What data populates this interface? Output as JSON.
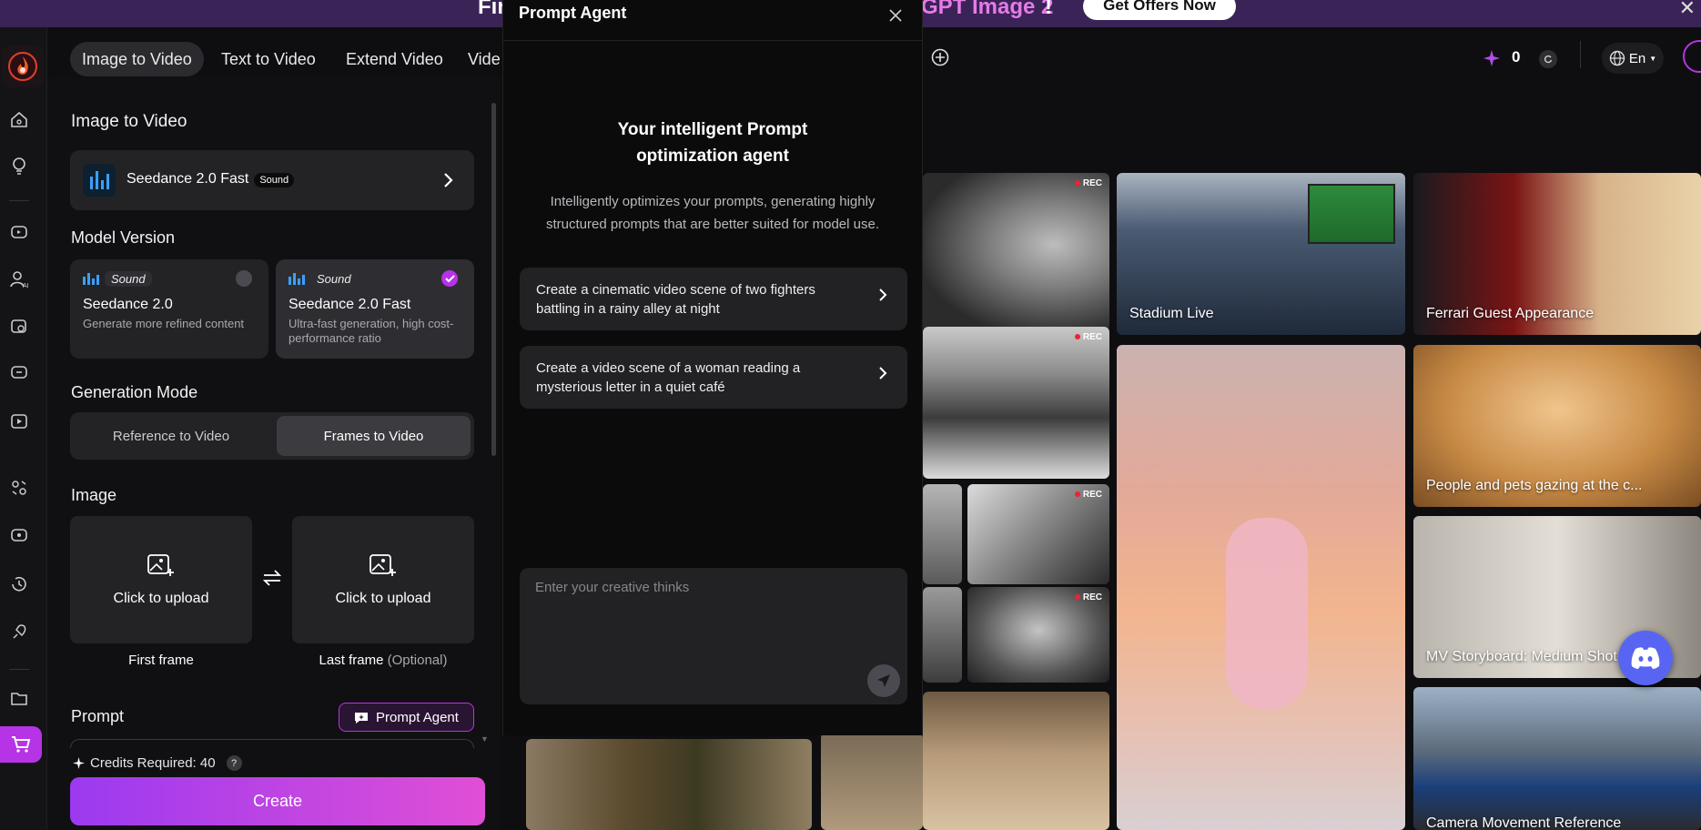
{
  "banner": {
    "left_text": "Fir",
    "mid_text": "GPT Image 2",
    "exclaim": "!",
    "offer_button": "Get Offers Now",
    "close": "✕"
  },
  "nav_tabs": [
    "Image to Video",
    "Text to Video",
    "Extend Video",
    "Vide"
  ],
  "header": {
    "credits": "0",
    "language": "En"
  },
  "panel": {
    "title": "Image to Video",
    "model": {
      "name": "Seedance 2.0 Fast",
      "badge": "Sound"
    },
    "model_version_label": "Model Version",
    "versions": [
      {
        "tag": "Sound",
        "name": "Seedance 2.0",
        "desc": "Generate more refined content",
        "selected": false
      },
      {
        "tag": "Sound",
        "name": "Seedance 2.0 Fast",
        "desc": "Ultra-fast generation, high cost-performance ratio",
        "selected": true
      }
    ],
    "generation_mode_label": "Generation Mode",
    "modes": [
      "Reference to Video",
      "Frames to Video"
    ],
    "image_label": "Image",
    "upload_text": "Click to upload",
    "first_frame": "First frame",
    "last_frame": "Last frame",
    "last_frame_optional": "(Optional)",
    "prompt_label": "Prompt",
    "prompt_agent_button": "Prompt Agent",
    "credits_required": "Credits Required: 40",
    "help": "?",
    "create_button": "Create"
  },
  "agent": {
    "title": "Prompt Agent",
    "heading_line1": "Your intelligent Prompt",
    "heading_line2": "optimization agent",
    "description": "Intelligently optimizes your prompts, generating highly structured prompts that are better suited for model use.",
    "suggestions": [
      "Create a cinematic video scene of two fighters battling in a rainy alley at night",
      "Create a video scene of a woman reading a mysterious letter in a quiet café"
    ],
    "input_placeholder": "Enter your creative thinks"
  },
  "gallery": {
    "captions": [
      "Stadium Live",
      "Ferrari Guest Appearance",
      "People and pets gazing at the c...",
      "MV Storyboard: Medium Shot o",
      "Camera Movement Reference"
    ],
    "rec_label": "REC"
  },
  "colors": {
    "accent": "#b733e6",
    "create_gradient_start": "#9b3af0",
    "create_gradient_end": "#e04fd6",
    "discord": "#5865f2"
  }
}
